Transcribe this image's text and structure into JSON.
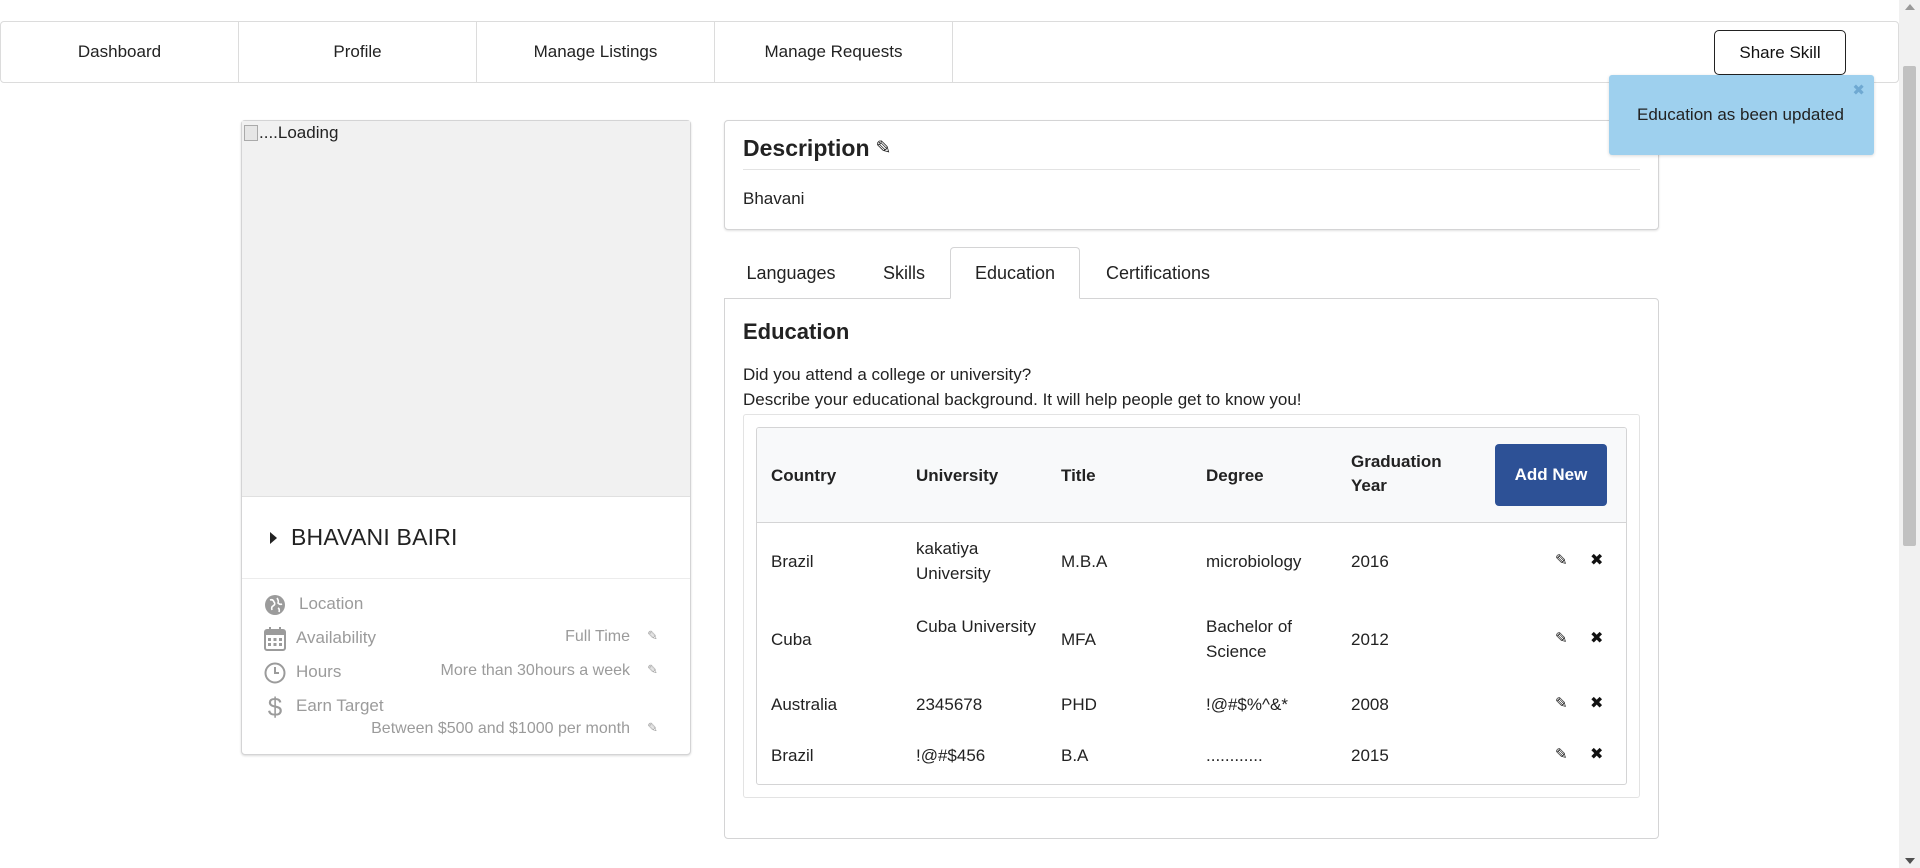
{
  "nav": {
    "items": [
      "Dashboard",
      "Profile",
      "Manage Listings",
      "Manage Requests"
    ],
    "share_label": "Share Skill"
  },
  "profile": {
    "image_alt": "....Loading",
    "name": "BHAVANI BAIRI",
    "location_label": "Location",
    "availability_label": "Availability",
    "availability_value": "Full Time",
    "hours_label": "Hours",
    "hours_value": "More than 30hours a week",
    "earn_label": "Earn Target",
    "earn_value": "Between $500 and $1000 per month"
  },
  "description": {
    "title": "Description",
    "text": "Bhavani"
  },
  "tabs": [
    "Languages",
    "Skills",
    "Education",
    "Certifications"
  ],
  "active_tab": "Education",
  "education": {
    "title": "Education",
    "line1": "Did you attend a college or university?",
    "line2": "Describe your educational background. It will help people get to know you!",
    "columns": [
      "Country",
      "University",
      "Title",
      "Degree",
      "Graduation Year"
    ],
    "add_label": "Add New",
    "rows": [
      [
        "Brazil",
        "kakatiya University",
        "M.B.A",
        "microbiology",
        "2016"
      ],
      [
        "Cuba",
        "Cuba University",
        "MFA",
        "Bachelor of Science",
        "2012"
      ],
      [
        "Australia",
        "2345678",
        "PHD",
        "!@#$%^&*",
        "2008"
      ],
      [
        "Brazil",
        "!@#$456",
        "B.A",
        "............",
        "2015"
      ]
    ]
  },
  "toast": {
    "message": "Education as been updated",
    "color": "#9ed0ee"
  },
  "colors": {
    "primary_button": "#2d5196"
  }
}
